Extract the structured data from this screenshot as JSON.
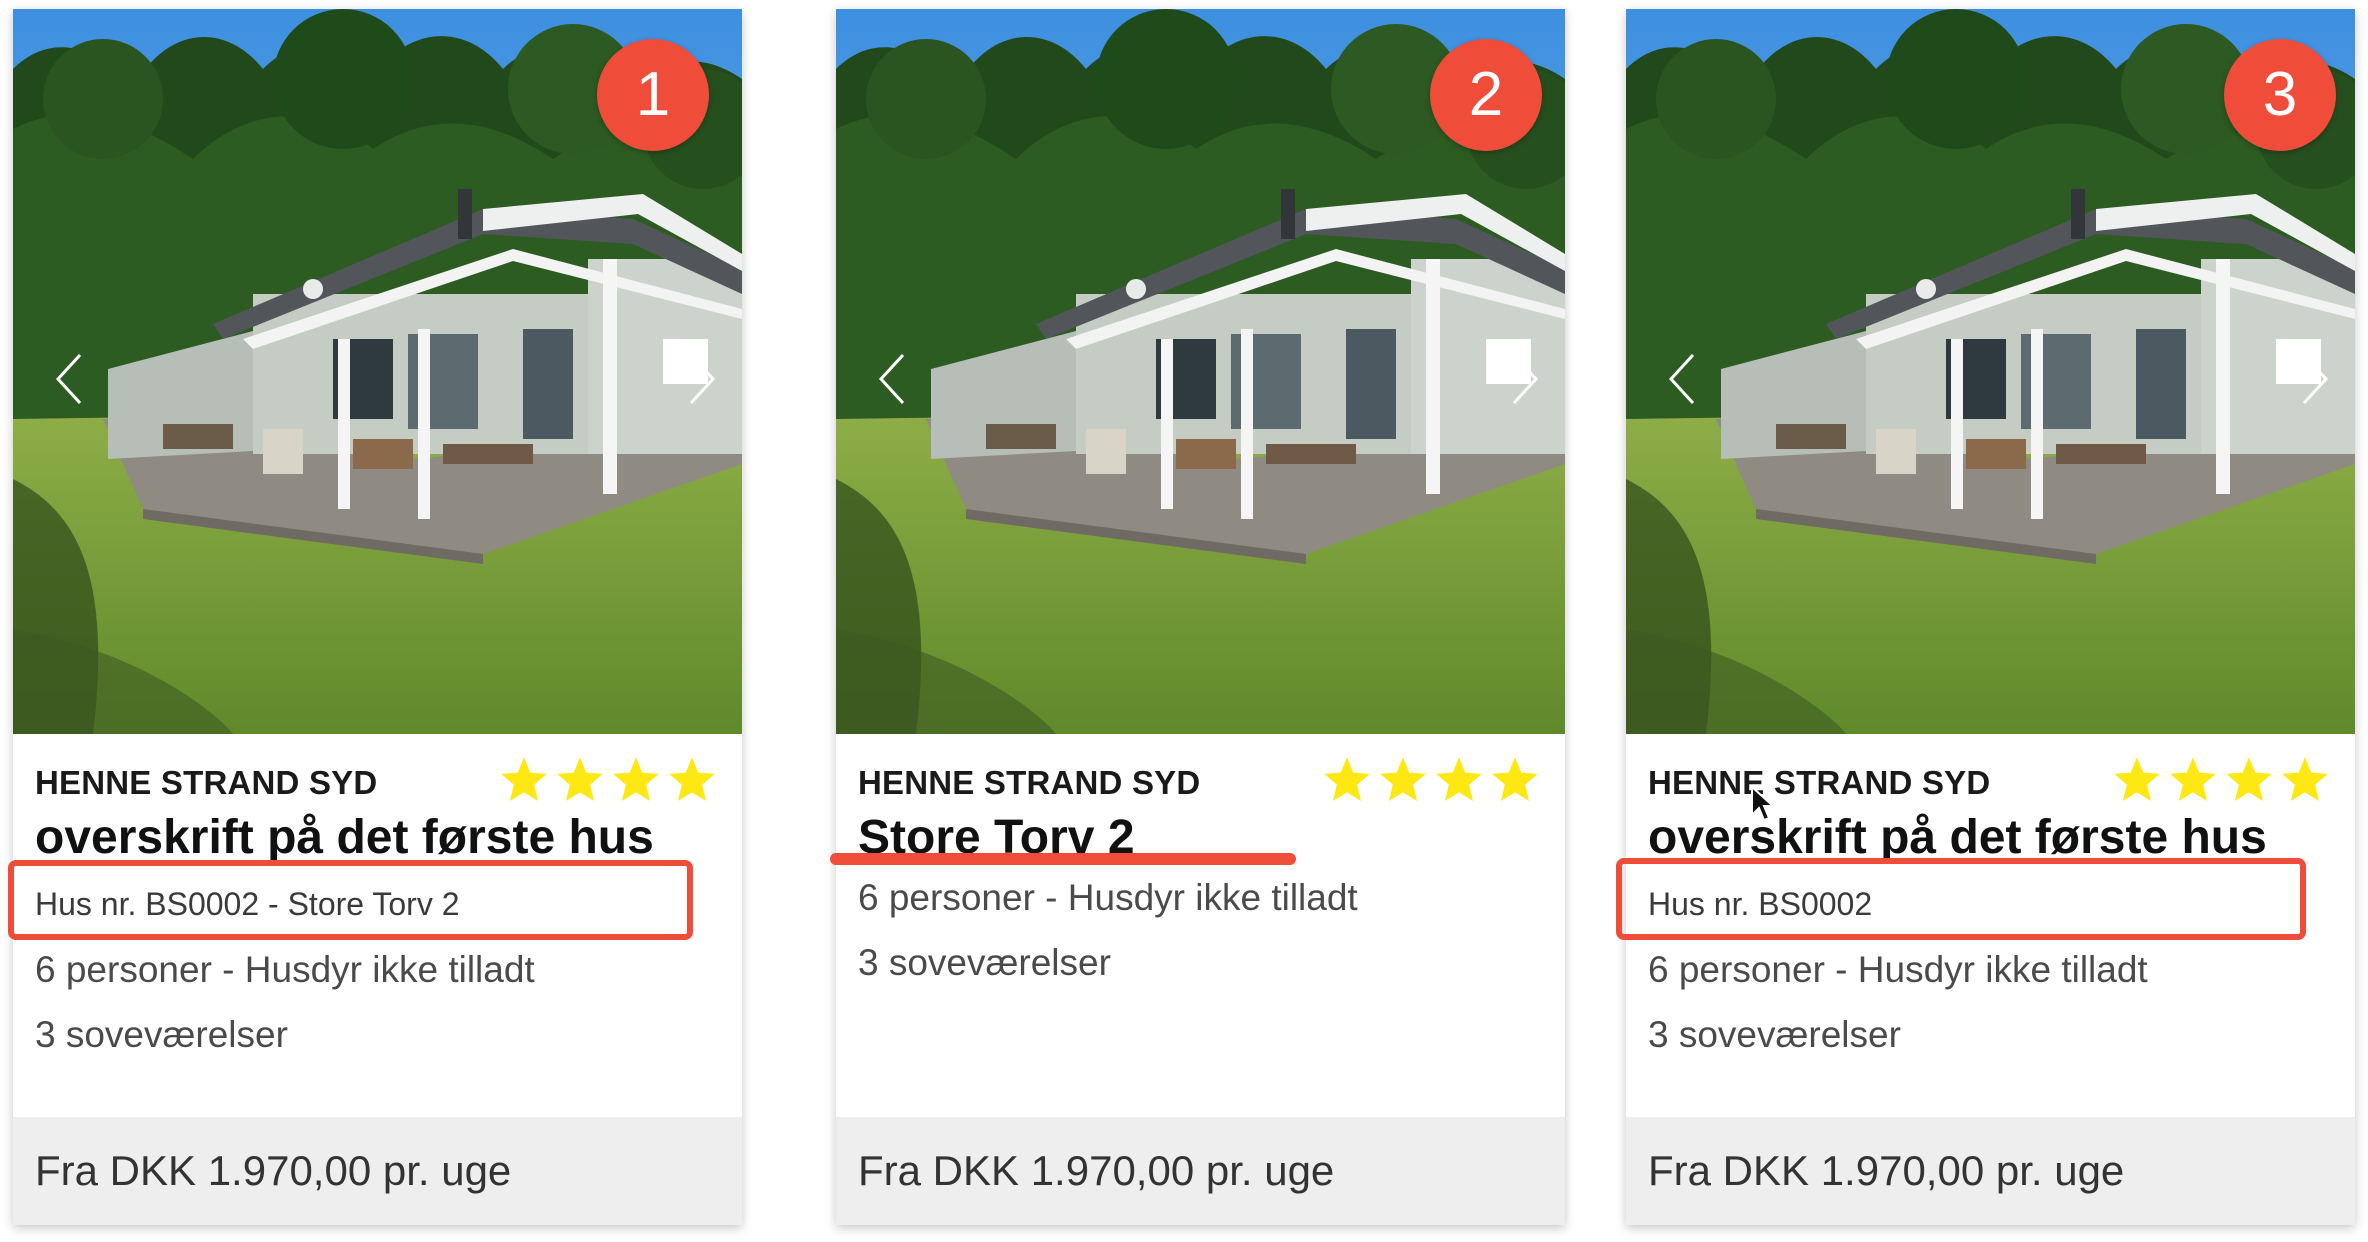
{
  "colors": {
    "badge": "#ef4c3a",
    "star": "#fde813",
    "annotation": "#ef4c3a",
    "footer_bg": "#eeeeee"
  },
  "cards": [
    {
      "badge": "1",
      "location": "HENNE STRAND SYD",
      "rating_stars": 4,
      "title": "overskrift på det første hus",
      "house_number": "Hus nr. BS0002 - Store Torv 2",
      "people_pets": "6 personer - Husdyr ikke tilladt",
      "bedrooms": "3 soveværelser",
      "price": "Fra DKK 1.970,00 pr. uge"
    },
    {
      "badge": "2",
      "location": "HENNE STRAND SYD",
      "rating_stars": 4,
      "title": "Store Torv 2",
      "people_pets": "6 personer - Husdyr ikke tilladt",
      "bedrooms": "3 soveværelser",
      "price": "Fra DKK 1.970,00 pr. uge"
    },
    {
      "badge": "3",
      "location": "HENNE STRAND SYD",
      "rating_stars": 4,
      "title": "overskrift på det første hus",
      "house_number": "Hus nr. BS0002",
      "people_pets": "6 personer - Husdyr ikke tilladt",
      "bedrooms": "3 soveværelser",
      "price": "Fra DKK 1.970,00 pr. uge"
    }
  ],
  "icons": {
    "prev": "chevron-left-icon",
    "next": "chevron-right-icon",
    "star": "star-icon",
    "cursor": "mouse-pointer-icon"
  }
}
